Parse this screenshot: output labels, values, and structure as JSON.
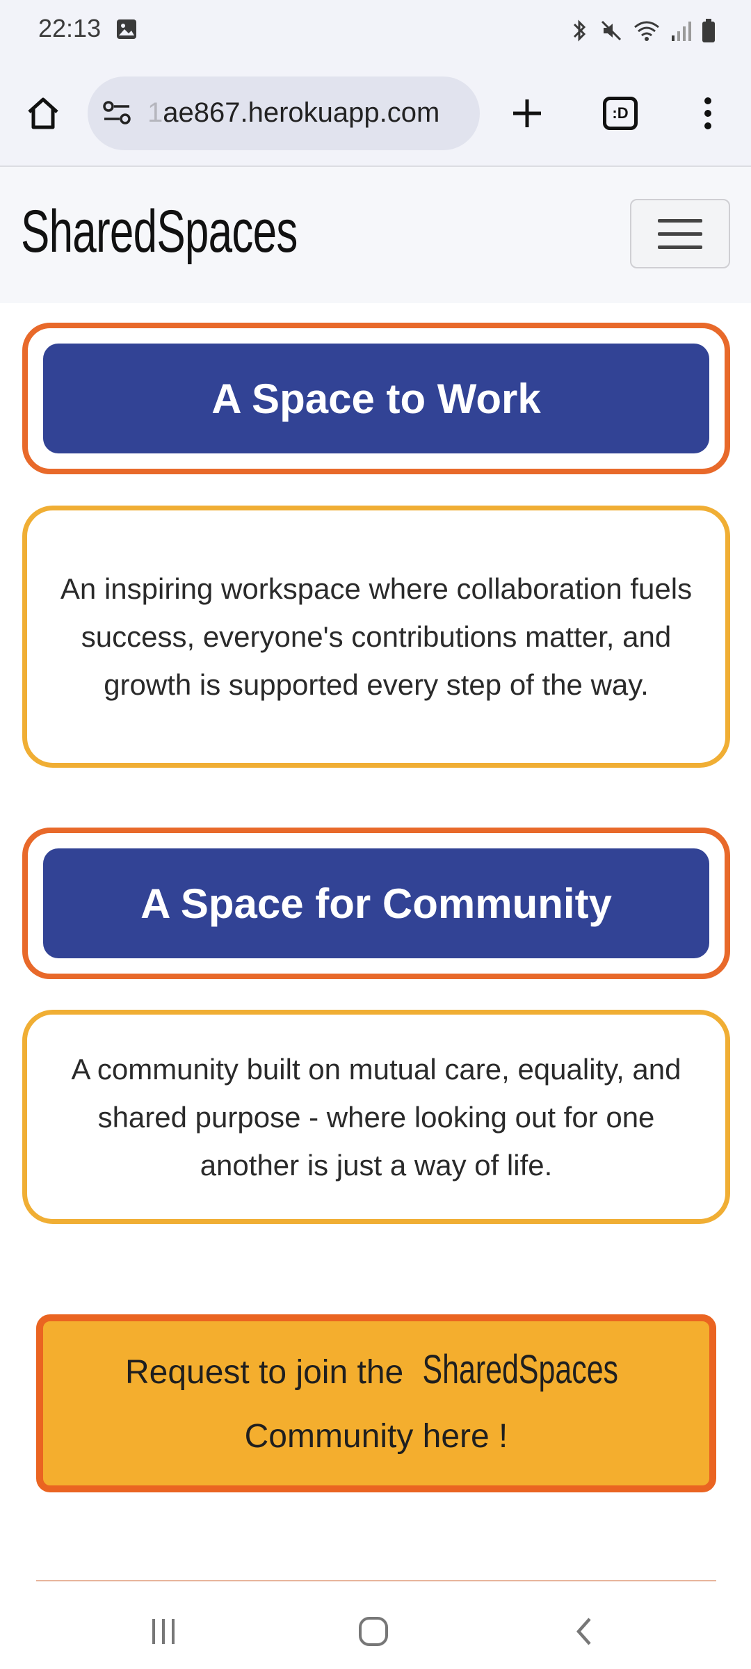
{
  "status_bar": {
    "time": "22:13",
    "icons": [
      "image-icon",
      "bluetooth-icon",
      "mute-icon",
      "wifi-icon",
      "signal-icon",
      "battery-icon"
    ]
  },
  "browser": {
    "url_prefix": "1",
    "url": "ae867.herokuapp.com",
    "tabs_label": ":D",
    "icons": [
      "home-icon",
      "site-settings-icon",
      "plus-icon",
      "tabs-icon",
      "more-vert-icon"
    ]
  },
  "site": {
    "brand": "SharedSpaces"
  },
  "sections": [
    {
      "heading": "A Space to Work",
      "body": "An inspiring workspace where collaboration fuels success, everyone's contributions matter, and growth is supported every step of the way."
    },
    {
      "heading": "A Space for Community",
      "body": "A community built on mutual care, equality, and shared purpose - where looking out for one another is just a way of life."
    }
  ],
  "cta": {
    "prefix": "Request to join the",
    "brand": "SharedSpaces",
    "suffix": "Community here !"
  },
  "colors": {
    "heading_bg": "#324395",
    "heading_border": "#e8692a",
    "text_border": "#f0ae34",
    "cta_bg": "#f4ae2e",
    "cta_border": "#ea6421"
  }
}
